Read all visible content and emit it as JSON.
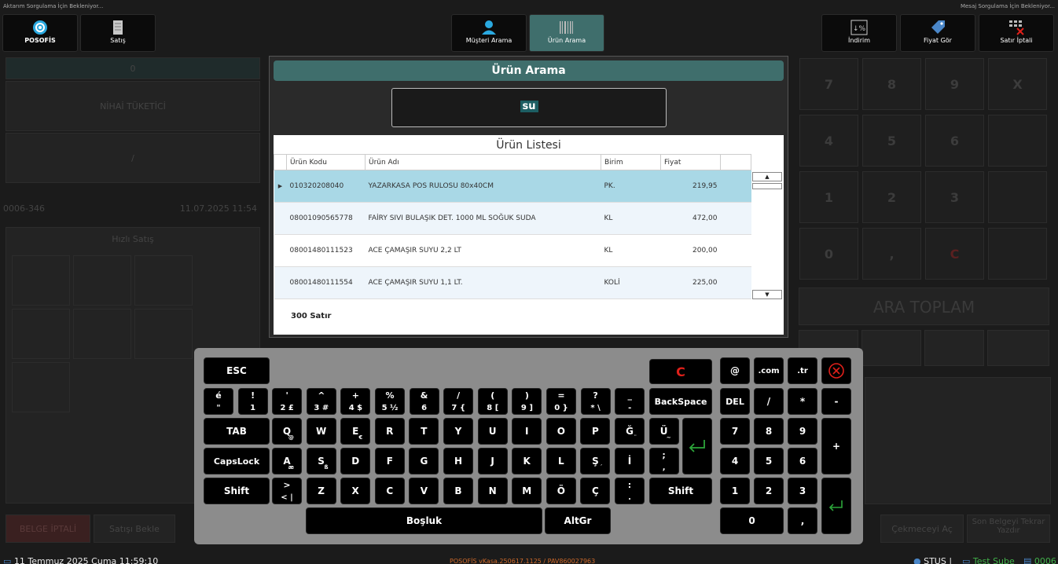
{
  "status": {
    "left": "Aktarım Sorgulama İçin Bekleniyor...",
    "right": "Mesaj Sorgulama İçin Bekleniyor..."
  },
  "top_buttons": {
    "posofis": "POSOFİS",
    "satis": "Satış",
    "musteri_arama": "Müşteri Arama",
    "urun_arama": "Ürün Arama",
    "indirim": "İndirim",
    "fiyat_gor": "Fiyat Gör",
    "satir_iptali": "Satır İptali"
  },
  "left_panel": {
    "zero": "0",
    "customer": "NİHAİ TÜKETİCİ",
    "slash": "/",
    "receipt_no": "0006-346",
    "receipt_date": "11.07.2025 11:54",
    "hizli_satis": "Hızlı Satış"
  },
  "keypad_dim": [
    "7",
    "8",
    "9",
    "X",
    "4",
    "5",
    "6",
    "",
    "1",
    "2",
    "3",
    "",
    "0",
    ",",
    "C",
    ""
  ],
  "ara_toplam": "ARA TOPLAM",
  "modal": {
    "title": "Ürün Arama",
    "search_value": "su",
    "list_title": "Ürün Listesi",
    "columns": [
      "Ürün Kodu",
      "Ürün Adı",
      "Birim",
      "Fiyat"
    ],
    "rows": [
      {
        "code": "010320208040",
        "name": "YAZARKASA POS RULOSU 80x40CM",
        "unit": "PK.",
        "price": "219,95"
      },
      {
        "code": "08001090565778",
        "name": "FAİRY SIVI BULAŞIK DET. 1000 ML SOĞUK SUDA",
        "unit": "KL",
        "price": "472,00"
      },
      {
        "code": "08001480111523",
        "name": "ACE ÇAMAŞIR SUYU 2,2 LT",
        "unit": "KL",
        "price": "200,00"
      },
      {
        "code": "08001480111554",
        "name": "ACE ÇAMAŞIR SUYU 1,1 LT.",
        "unit": "KOLİ",
        "price": "225,00"
      }
    ],
    "row_count": "300 Satır"
  },
  "keyboard": {
    "esc": "ESC",
    "clear": "C",
    "at": "@",
    "dotcom": ".com",
    "dottr": ".tr",
    "backspace": "BackSpace",
    "del": "DEL",
    "tab": "TAB",
    "capslock": "CapsLock",
    "shift": "Shift",
    "space": "Boşluk",
    "altgr": "AltGr",
    "num_row": [
      {
        "top": "é",
        "sub": "\""
      },
      {
        "top": "!",
        "sub": "1"
      },
      {
        "top": "'",
        "sub": "2 £"
      },
      {
        "top": "^",
        "sub": "3 #"
      },
      {
        "top": "+",
        "sub": "4 $"
      },
      {
        "top": "%",
        "sub": "5 ½"
      },
      {
        "top": "&",
        "sub": "6"
      },
      {
        "top": "/",
        "sub": "7 {"
      },
      {
        "top": "(",
        "sub": "8 ["
      },
      {
        "top": ")",
        "sub": "9 ]"
      },
      {
        "top": "=",
        "sub": "0 }"
      },
      {
        "top": "?",
        "sub": "* \\"
      },
      {
        "top": "_",
        "sub": "-"
      }
    ],
    "q_row": [
      "Q",
      "W",
      "E",
      "R",
      "T",
      "Y",
      "U",
      "I",
      "O",
      "P",
      "Ğ",
      "Ü"
    ],
    "q_row_alt": {
      "Q": "@",
      "E": "€",
      "Ğ": "¨",
      "Ü": "~"
    },
    "a_row": [
      "A",
      "S",
      "D",
      "F",
      "G",
      "H",
      "J",
      "K",
      "L",
      "Ş",
      "İ"
    ],
    "a_row_alt": {
      "A": "æ",
      "S": "ß",
      "Ş": "´"
    },
    "a_row_semicolon": {
      "top": ";",
      "sub": ","
    },
    "z_row_first": {
      "top": ">",
      "sub": "< |"
    },
    "z_row": [
      "Z",
      "X",
      "C",
      "V",
      "B",
      "N",
      "M",
      "Ö",
      "Ç"
    ],
    "z_row_colon": {
      "top": ":",
      "sub": "."
    },
    "numpad": [
      "7",
      "8",
      "9",
      "4",
      "5",
      "6",
      "1",
      "2",
      "3"
    ],
    "star": "*",
    "minus": "-",
    "slash": "/",
    "plus": "+",
    "zero": "0",
    "comma": ","
  },
  "bottom_buttons_dim": {
    "belge_iptali": "BELGE İPTALİ",
    "satis_bekle": "Satışı Bekle",
    "cekmeceyi_ac": "Çekmeceyi Aç",
    "son_belgeyi_tekrar_yazdir": "Son Belgeyi Tekrar Yazdır"
  },
  "footer": {
    "date": "11 Temmuz 2025 Cuma 11:59:10",
    "version": "POSOFİS vKasa.250617.1125 / PAV860027963",
    "user": "STUS",
    "branch": "Test Şube",
    "kasa": "0006"
  },
  "colors": {
    "accent": "#3f6e6c",
    "selected_row": "#a9d8e6",
    "clear_red": "#e0201a",
    "footer_green": "#41b04a",
    "footer_orange": "#d06a2a"
  }
}
